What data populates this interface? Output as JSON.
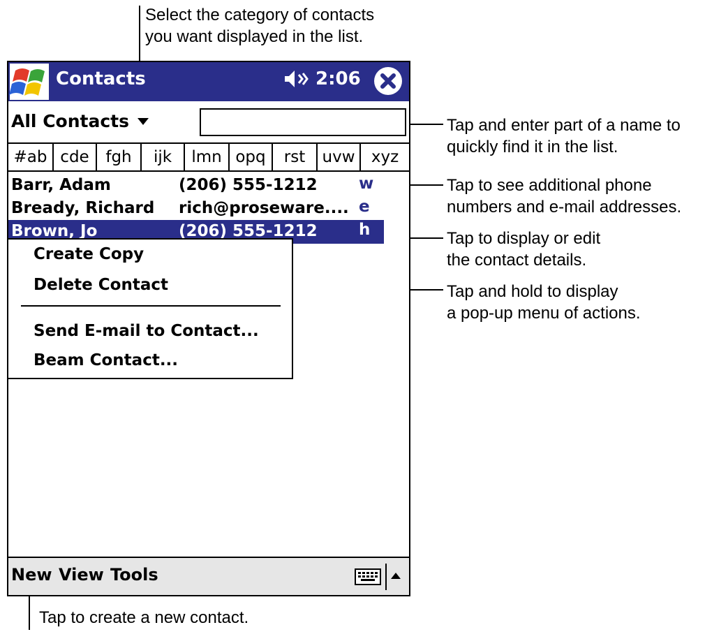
{
  "callouts": {
    "category": [
      "Select the category of contacts",
      "you want displayed in the list."
    ],
    "find": [
      "Tap and enter part of a name to",
      "quickly find it in the list."
    ],
    "phones": [
      "Tap to see additional phone",
      "numbers and e-mail addresses."
    ],
    "details": [
      "Tap to display or edit",
      "the contact details."
    ],
    "popup": [
      "Tap and hold to display",
      "a pop-up menu of actions."
    ],
    "new_contact": "Tap to create a new contact."
  },
  "titlebar": {
    "app_title": "Contacts",
    "time": "2:06",
    "volume_icon": "speaker-icon"
  },
  "category": {
    "selected": "All Contacts",
    "find_placeholder": ""
  },
  "abc_tabs": [
    "#ab",
    "cde",
    "fgh",
    "ijk",
    "lmn",
    "opq",
    "rst",
    "uvw",
    "xyz"
  ],
  "contacts": [
    {
      "name": "Barr, Adam",
      "info": "(206) 555-1212",
      "type": "w"
    },
    {
      "name": "Bready, Richard",
      "info": "rich@proseware....",
      "type": "e"
    },
    {
      "name": "Brown, Jo",
      "info": "(206) 555-1212",
      "type": "h"
    }
  ],
  "popup_menu": {
    "group1": [
      "Create Copy",
      "Delete Contact"
    ],
    "group2": [
      "Send E-mail to Contact...",
      "Beam Contact..."
    ]
  },
  "menubar": {
    "items": [
      "New",
      "View",
      "Tools"
    ]
  },
  "colors": {
    "titlebar": "#2a2e8a",
    "selection": "#2a2e8a",
    "menubar": "#e6e6e6"
  }
}
